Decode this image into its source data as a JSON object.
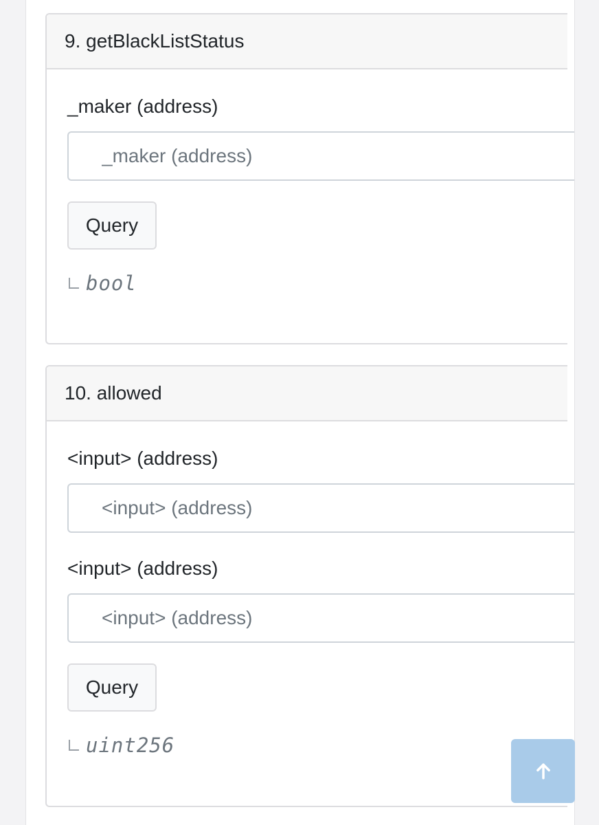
{
  "functions": [
    {
      "title": "9. getBlackListStatus",
      "inputs": [
        {
          "label": "_maker (address)",
          "placeholder": "_maker (address)",
          "value": ""
        }
      ],
      "button_label": "Query",
      "result_type": "bool"
    },
    {
      "title": "10. allowed",
      "inputs": [
        {
          "label": "<input> (address)",
          "placeholder": "<input> (address)",
          "value": ""
        },
        {
          "label": "<input> (address)",
          "placeholder": "<input> (address)",
          "value": ""
        }
      ],
      "button_label": "Query",
      "result_type": "uint256"
    }
  ],
  "scroll_top": {
    "icon": "arrow-up-icon",
    "color": "#a9cbe9"
  }
}
